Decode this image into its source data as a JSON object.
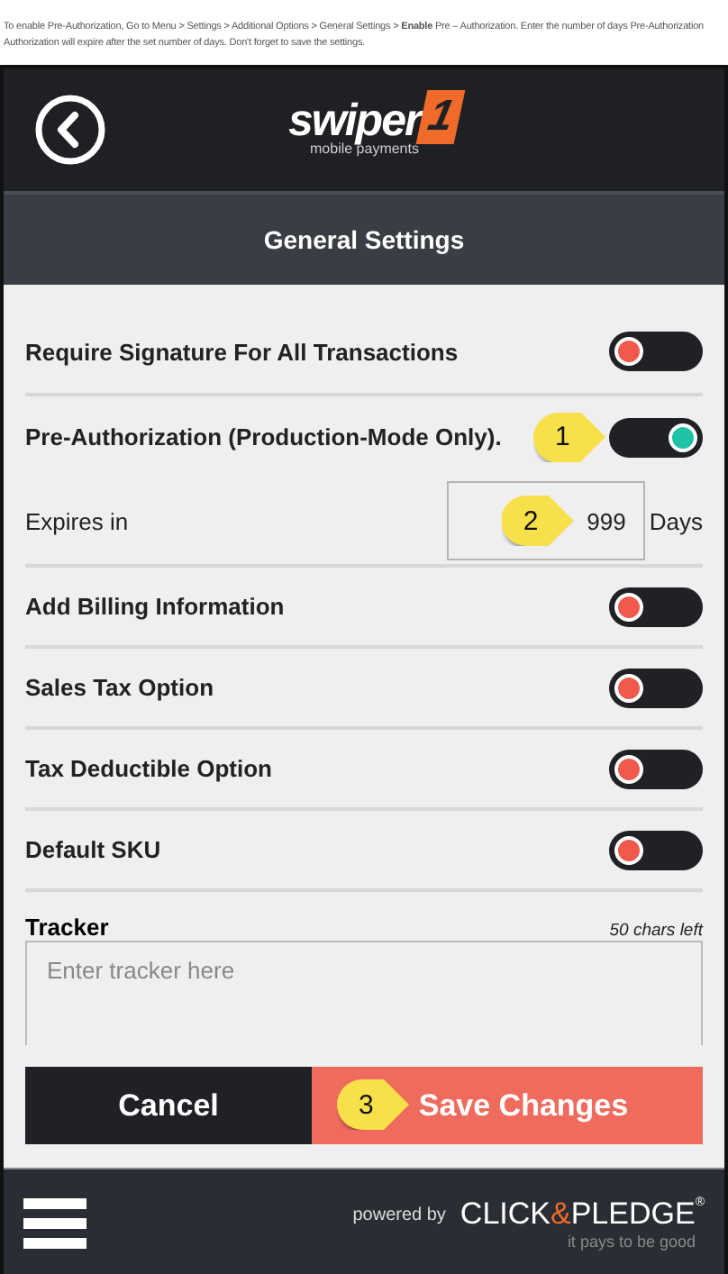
{
  "instructions": [
    "To enable Pre-Authorization, Go to Menu > Settings > Additional Options > General Settings > **Enable** Pre – Authorization. Enter the number of days Pre-Authorization",
    "Authorization will expire after the set number of days. Don't forget to save the settings."
  ],
  "header": {
    "logo": {
      "word": "swiper",
      "digit": "1",
      "tagline": "mobile payments"
    }
  },
  "title": "General Settings",
  "settings": [
    {
      "kind": "toggle",
      "label": "Require Signature For All Transactions",
      "on": false
    },
    {
      "kind": "toggle",
      "label": "Pre-Authorization (Production-Mode Only).",
      "on": true,
      "callout": "1"
    },
    {
      "kind": "number",
      "label": "Expires in",
      "value": "999",
      "unit": "Days",
      "callout": "2"
    },
    {
      "kind": "toggle",
      "label": "Add Billing Information",
      "on": false
    },
    {
      "kind": "toggle",
      "label": "Sales Tax Option",
      "on": false
    },
    {
      "kind": "toggle",
      "label": "Tax Deductible Option",
      "on": false
    },
    {
      "kind": "toggle",
      "label": "Default SKU",
      "on": false
    }
  ],
  "tracker": {
    "label": "Tracker",
    "counter": "50 chars left",
    "placeholder": "Enter tracker here"
  },
  "buttons": [
    {
      "kind": "cancel",
      "label": "Cancel"
    },
    {
      "kind": "save",
      "label": "Save Changes",
      "callout": "3"
    }
  ],
  "footer": {
    "powered_by": "powered by",
    "brand": [
      "CLICK",
      "&",
      "PLEDGE"
    ],
    "registered": "®",
    "slogan": "it pays to be good"
  }
}
